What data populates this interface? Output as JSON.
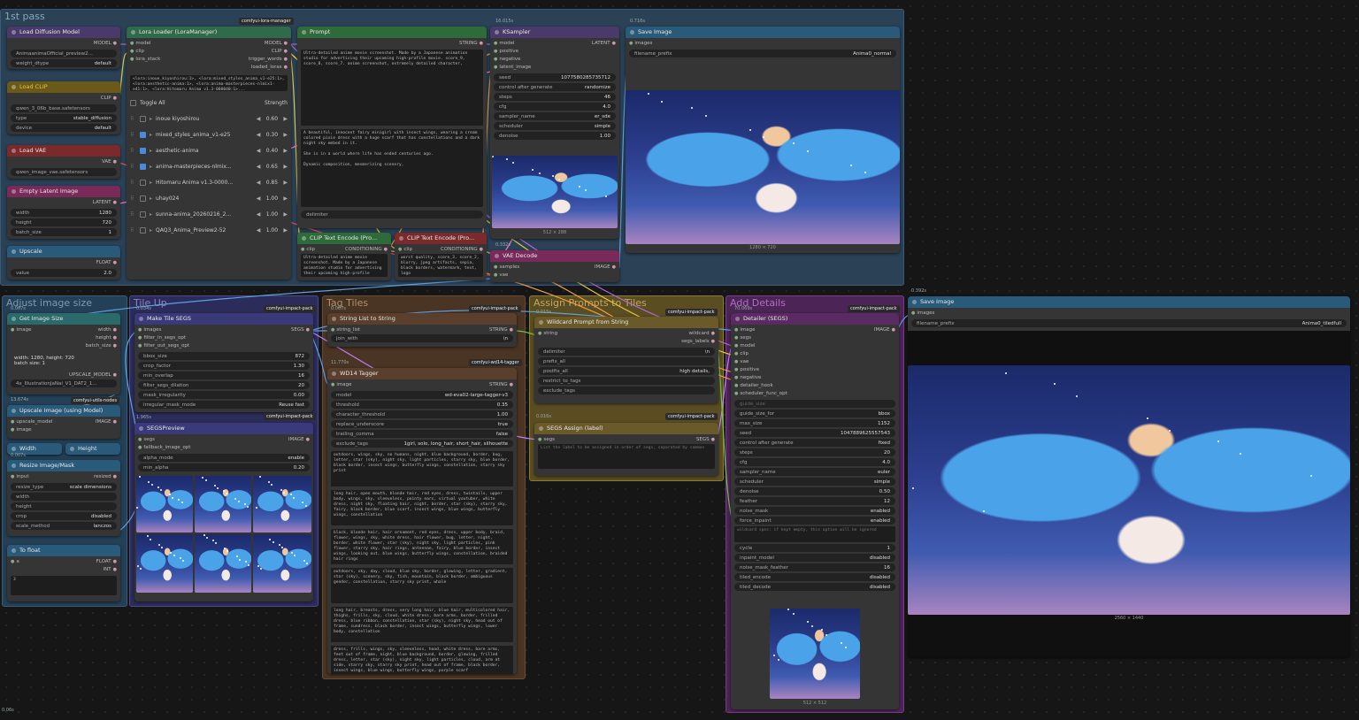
{
  "groups": {
    "first_pass": "1st pass",
    "adjust": "Adjust image size",
    "tile": "Tile Up",
    "tag_tiles": "Tag Tiles",
    "assign": "Assign Prompts to Tiles",
    "add_details": "Add Details"
  },
  "badges": {
    "lora_manager": "comfyui-lora-manager",
    "impact1": "comfyui-impact-pack",
    "impact2": "comfyui-impact-pack",
    "impact3": "comfyui-impact-pack",
    "impact4": "comfyui-impact-pack",
    "impact5": "comfyui-impact-pack",
    "impact6": "comfyui-impact-pack",
    "utils": "comfyui-utils-nodes",
    "wd14": "comfyui-wd14-tagger"
  },
  "timers": {
    "ksampler": "16.015s",
    "save1": "0.716s",
    "vae": "0.332s",
    "getsize": "0.007s",
    "tile": "0.034s",
    "tag": "0.007s",
    "wd": "11.770s",
    "assign": "0.015s",
    "segs_assign": "0.016s",
    "detail": "70.069s",
    "upscale": "13.674s",
    "preview": "1.965s",
    "save2": "0.392s",
    "width_t": "0.007s",
    "corner": "0.06s"
  },
  "load_model": {
    "title": "Load Diffusion Model",
    "out": "MODEL",
    "w1_label": "AnimaanimaOfficial_preview2...",
    "w2_label": "weight_dtype",
    "w2_value": "default"
  },
  "load_clip": {
    "title": "Load CLIP",
    "out": "CLIP",
    "w1_label": "qwen_3_06b_base.safetensors",
    "w2_label": "type",
    "w2_value": "stable_diffusion",
    "w3_label": "device",
    "w3_value": "default"
  },
  "load_vae": {
    "title": "Load VAE",
    "out": "VAE",
    "w1_label": "qwen_image_vae.safetensors"
  },
  "latent": {
    "title": "Empty Latent Image",
    "out": "LATENT",
    "width_label": "width",
    "width_value": "1280",
    "height_label": "height",
    "height_value": "720",
    "batch_label": "batch_size",
    "batch_value": "1"
  },
  "upscale_val": {
    "title": "Upscale",
    "out": "FLOAT",
    "label": "value",
    "value": "2.0"
  },
  "lora": {
    "title": "Lora Loader (LoraManager)",
    "in1": "model",
    "in2": "clip",
    "in3": "lora_stack",
    "out1": "MODEL",
    "out2": "CLIP",
    "out3": "trigger_words",
    "out4": "loaded_loras",
    "text": "<lora:inoue_kiyoshirou:1>, <lora:mixed_styles_anima_v1-e25:1>, <lora:aesthetic-anima:1>, <lora:anima-masterpieces-nlmix1-e41:1>, <lora:Hitomaru Anima v1.3-000040:1>...",
    "toggle": "Toggle All",
    "strength": "Strength",
    "rows": [
      {
        "name": "inoue kiyoshirou",
        "value": "0.60"
      },
      {
        "name": "mixed_styles_anima_v1-e25",
        "value": "0.30"
      },
      {
        "name": "aesthetic-anima",
        "value": "0.40"
      },
      {
        "name": "anima-masterpieces-nlmix...",
        "value": "0.65"
      },
      {
        "name": "Hitomaru Anima v1.3-0000...",
        "value": "0.85"
      },
      {
        "name": "uhay024",
        "value": "1.00"
      },
      {
        "name": "sunna-anima_20260216_2...",
        "value": "1.00"
      },
      {
        "name": "QAQ3_Anima_Preview2-52",
        "value": "1.00"
      }
    ]
  },
  "prompt": {
    "title": "Prompt",
    "out": "STRING",
    "text1": "Ultra-detailed anime movie screenshot. Made by a Japanese animation studio for advertising their upcoming high-profile movie. score_9, score_8, score_7. anime screenshot, extremely detailed character,",
    "text2": "A beautiful, innocent fairy minigirl with insect wings, wearing a cream colored pixie dress with a huge scarf that has constellations and a dark night sky embed in it.\n\nShe is in a world where life has ended centuries ago.\n\nDynamic composition, mesmerizing scenery,",
    "delimiter": "delimiter"
  },
  "clip_pos": {
    "title": "CLIP Text Encode (Pro...",
    "in": "clip",
    "out": "CONDITIONING",
    "text": "Ultra-detailed anime movie screenshot. Made by a Japanese animation studio for advertising their upcoming high-profile"
  },
  "clip_neg": {
    "title": "CLIP Text Encode (Pro...",
    "in": "clip",
    "out": "CONDITIONING",
    "text": "worst quality, score_3, score_2, blurry, jpeg artifacts, sepia, black borders, watermark, text, logo"
  },
  "ksampler": {
    "title": "KSampler",
    "in": [
      "model",
      "positive",
      "negative",
      "latent_image"
    ],
    "out": "LATENT",
    "widgets": [
      {
        "label": "seed",
        "value": "1077580285735712"
      },
      {
        "label": "control after generate",
        "value": "randomize"
      },
      {
        "label": "steps",
        "value": "46"
      },
      {
        "label": "cfg",
        "value": "4.0"
      },
      {
        "label": "sampler_name",
        "value": "er_sde"
      },
      {
        "label": "scheduler",
        "value": "simple"
      },
      {
        "label": "denoise",
        "value": "1.00"
      }
    ],
    "img_size": "512 × 288"
  },
  "vae_decode": {
    "title": "VAE Decode",
    "in1": "samples",
    "in2": "vae",
    "out": "IMAGE"
  },
  "save1": {
    "title": "Save Image",
    "in": "images",
    "prefix_label": "filename_prefix",
    "prefix_value": "Anima0_normal",
    "img_size": "1280 × 720"
  },
  "get_size": {
    "title": "Get Image Size",
    "in": "image",
    "outs": [
      "width",
      "height",
      "batch_size"
    ],
    "info": "width: 1280, height: 720\nbatch size: 1",
    "upscale_model_out": "UPSCALE_MODEL",
    "model_name": "4x_IllustrationJaNai_V1_DAT2_1..."
  },
  "upscale_img": {
    "title": "Upscale Image (using Model)",
    "in1": "upscale_model",
    "in2": "image",
    "out": "IMAGE"
  },
  "width_node": {
    "a": "Width",
    "b": "Height"
  },
  "resize": {
    "title": "Resize Image/Mask",
    "in": "input",
    "out": "resized",
    "widgets": [
      {
        "label": "resize_type",
        "value": "scale dimensions"
      },
      {
        "label": "width",
        "value": ""
      },
      {
        "label": "height",
        "value": ""
      },
      {
        "label": "crop",
        "value": "disabled"
      },
      {
        "label": "scale_method",
        "value": "lanczos"
      }
    ]
  },
  "to_float": {
    "title": "To float",
    "in": "a",
    "out1": "FLOAT",
    "out2": "INT",
    "value": "3"
  },
  "make_tile": {
    "title": "Make Tile SEGS",
    "ins": [
      "images",
      "filter_in_segs_opt",
      "filter_out_segs_opt"
    ],
    "out": "SEGS",
    "widgets": [
      {
        "label": "bbox_size",
        "value": "872"
      },
      {
        "label": "crop_factor",
        "value": "1.30"
      },
      {
        "label": "min_overlap",
        "value": "16"
      },
      {
        "label": "filter_segs_dilation",
        "value": "20"
      },
      {
        "label": "mask_irregularity",
        "value": "0.00"
      },
      {
        "label": "irregular_mask_mode",
        "value": "Reuse fast"
      }
    ]
  },
  "segs_preview": {
    "title": "SEGSPreview",
    "ins": [
      "segs",
      "fallback_image_opt"
    ],
    "out": "IMAGE",
    "widgets": [
      {
        "label": "alpha_mode",
        "value": "enable"
      },
      {
        "label": "min_alpha",
        "value": "0.20"
      }
    ]
  },
  "list_to_string": {
    "title": "String List to String",
    "in": "string_list",
    "out": "STRING",
    "join_label": "join_with",
    "join_value": "\\n"
  },
  "wd14": {
    "title": "WD14 Tagger",
    "in": "image",
    "out": "STRING",
    "widgets": [
      {
        "label": "model",
        "value": "wd-eva02-large-tagger-v3"
      },
      {
        "label": "threshold",
        "value": "0.35"
      },
      {
        "label": "character_threshold",
        "value": "1.00"
      },
      {
        "label": "replace_underscore",
        "value": "true"
      },
      {
        "label": "trailing_comma",
        "value": "false"
      },
      {
        "label": "exclude_tags",
        "value": "1girl, solo, long_hair, short_hair, silhouette"
      }
    ],
    "outputs": [
      "outdoors, wings, sky, no humans, night, blue background, border, bug, letter, star (sky), night sky, light particles, starry sky, blue border, black border, insect wings, butterfly wings, constellation, starry sky print",
      "long hair, open mouth, blonde hair, red eyes, dress, twintails, upper body, wings, sky, sleeveless, pointy ears, virtual youtuber, white dress, night sky, floating hair, night, border, star (sky), starry sky, fairy, black border, blue scarf, insect wings, blue wings, butterfly wings, constellation",
      "black, blonde hair, hair ornament, red eyes, dress, upper body, braid, flower, wings, sky, white dress, hair flower, bug, letter, night, border, white flower, star (sky), night sky, light particles, pink flower, starry sky, hair rings, antennae, fairy, blue border, insect wings, looking out, blue wings, butterfly wings, constellation, braided hair rings",
      "outdoors, sky, day, cloud, blue sky, border, glowing, letter, gradient, star (sky), scenery, sky, fish, mountain, black border, ambiguous gender, constellation, starry sky print, whale",
      "long hair, breasts, dress, very long hair, blue hair, multicolored hair, thighs, frills, sky, cloud, white dress, bare arms, border, frilled dress, blue ribbon, constellation, star (sky), night sky, head out of frame, sundress, black border, insect wings, butterfly wings, lower body, constellation",
      "dress, frills, wings, sky, sleeveless, hood, white dress, bare arms, feet out of frame, night, blue background, border, glowing, frilled dress, letter, star (sky), night sky, light particles, cloud, arm at side, starry sky, starry sky print, head out of frame, black border, insect wings, blue wings, butterfly wings, purple scarf"
    ]
  },
  "wildcard": {
    "title": "Wildcard Prompt from String",
    "in": "string",
    "outs": [
      "wildcard",
      "segs_labels"
    ],
    "widgets": [
      {
        "label": "delimiter",
        "value": "\\n"
      },
      {
        "label": "prefix_all",
        "value": ""
      },
      {
        "label": "postfix_all",
        "value": "high details,"
      },
      {
        "label": "restrict_to_tags",
        "value": ""
      },
      {
        "label": "exclude_tags",
        "value": ""
      }
    ]
  },
  "segs_assign": {
    "title": "SEGS Assign (label)",
    "in": "segs",
    "out": "SEGS",
    "placeholder": "List the label to be assigned in order of segs, separated by commas"
  },
  "detailer": {
    "title": "Detailer (SEGS)",
    "ins": [
      "image",
      "segs",
      "model",
      "clip",
      "vae",
      "positive",
      "negative",
      "detailer_hook",
      "scheduler_func_opt"
    ],
    "out": "IMAGE",
    "guide_size": "guide_size",
    "widgets": [
      {
        "label": "guide_size_for",
        "value": "bbox"
      },
      {
        "label": "max_size",
        "value": "1152"
      },
      {
        "label": "seed",
        "value": "1047889625557543"
      },
      {
        "label": "control after generate",
        "value": "fixed"
      },
      {
        "label": "steps",
        "value": "20"
      },
      {
        "label": "cfg",
        "value": "4.0"
      },
      {
        "label": "sampler_name",
        "value": "euler"
      },
      {
        "label": "scheduler",
        "value": "simple"
      },
      {
        "label": "denoise",
        "value": "0.50"
      },
      {
        "label": "feather",
        "value": "12"
      },
      {
        "label": "noise_mask",
        "value": "enabled"
      },
      {
        "label": "force_inpaint",
        "value": "enabled"
      }
    ],
    "wildcard_text": "wildcard spec: if kept empty, this option will be ignored",
    "widgets2": [
      {
        "label": "cycle",
        "value": "1"
      },
      {
        "label": "inpaint_model",
        "value": "disabled"
      },
      {
        "label": "noise_mask_feather",
        "value": "16"
      },
      {
        "label": "tiled_encode",
        "value": "disabled"
      },
      {
        "label": "tiled_decode",
        "value": "disabled"
      }
    ],
    "img_size": "512 × 512"
  },
  "save2": {
    "title": "Save Image",
    "in": "images",
    "prefix_label": "filename_prefix",
    "prefix_value": "Anima0_tiledfull",
    "img_size": "2560 × 1440"
  },
  "colors": {
    "group_blue": "#2a4a6a",
    "group_brown": "#5a3f2c",
    "group_gold": "#6a5a2a",
    "group_purple": "#5a2a62",
    "green_head": "#2f6a3a",
    "purple_head": "#5a3a8a",
    "red_head": "#7a2a2a",
    "pink_head": "#7a2a5a",
    "teal_head": "#2a6a6a"
  }
}
